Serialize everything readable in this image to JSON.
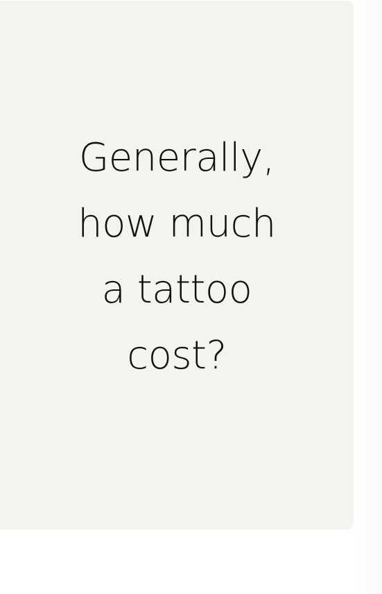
{
  "card": {
    "question_lines": [
      "Generally,",
      "how much",
      "a tattoo",
      "cost?"
    ]
  },
  "colors": {
    "card_background": "#f4f3f0",
    "page_background": "#ffffff",
    "text": "#111111"
  }
}
